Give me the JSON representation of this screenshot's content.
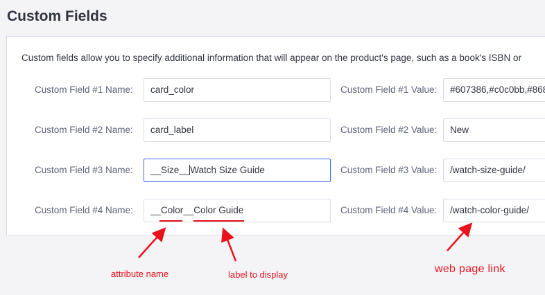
{
  "page": {
    "title": "Custom Fields"
  },
  "panel": {
    "intro": "Custom fields allow you to specify additional information that will appear on the product's page, such as a book's ISBN or"
  },
  "custom_fields": [
    {
      "name_label": "Custom Field #1 Name:",
      "name_value": "card_color",
      "value_label": "Custom Field #1 Value:",
      "value_value": "#607386,#c0c0bb,#868"
    },
    {
      "name_label": "Custom Field #2 Name:",
      "name_value": "card_label",
      "value_label": "Custom Field #2 Value:",
      "value_value": "New"
    },
    {
      "name_label": "Custom Field #3 Name:",
      "name_value_before_caret": "__Size__",
      "name_value_after_caret": "Watch Size Guide",
      "value_label": "Custom Field #3 Value:",
      "value_value": "/watch-size-guide/"
    },
    {
      "name_label": "Custom Field #4 Name:",
      "name_value": "__Color__Color Guide",
      "value_label": "Custom Field #4 Value:",
      "value_value": "/watch-color-guide/"
    }
  ],
  "annotations": {
    "attribute_name": "attribute name",
    "label_to_display": "label to display",
    "web_page_link": "web page link"
  },
  "colors": {
    "annotation": "#e8111c",
    "focus_border": "#3c64f4",
    "panel_border": "#d9dce9",
    "background": "#f4f4f6"
  }
}
